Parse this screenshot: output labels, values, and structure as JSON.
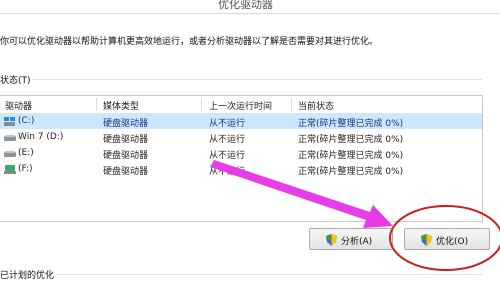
{
  "window": {
    "title": "优化驱动器"
  },
  "description": "你可以优化驱动器以帮助计算机更高效地运行，或者分析驱动器以了解是否需要对其进行优化。",
  "status_section": {
    "label": "状态(T)"
  },
  "table": {
    "headers": [
      "驱动器",
      "媒体类型",
      "上一次运行时间",
      "当前状态"
    ],
    "rows": [
      {
        "drive": "(C:)",
        "media": "硬盘驱动器",
        "last_run": "从不运行",
        "status": "正常(碎片整理已完成 0%)",
        "icon": "windows-drive-icon",
        "selected": true
      },
      {
        "drive": "Win 7 (D:)",
        "media": "硬盘驱动器",
        "last_run": "从不运行",
        "status": "正常(碎片整理已完成 0%)",
        "icon": "hard-drive-icon",
        "selected": false
      },
      {
        "drive": "(E:)",
        "media": "硬盘驱动器",
        "last_run": "从不运行",
        "status": "正常(碎片整理已完成 0%)",
        "icon": "hard-drive-icon",
        "selected": false
      },
      {
        "drive": "(F:)",
        "media": "硬盘驱动器",
        "last_run": "从不运行",
        "status": "正常(碎片整理已完成 0%)",
        "icon": "network-drive-icon",
        "selected": false
      }
    ]
  },
  "buttons": {
    "analyze": "分析(A)",
    "optimize": "优化(O)"
  },
  "scheduled_section": {
    "label": "已计划的优化"
  },
  "annotations": {
    "arrow_color": "#e83ce6",
    "circle_color": "#c82020"
  },
  "colors": {
    "selected_row": "#cce8ff"
  }
}
